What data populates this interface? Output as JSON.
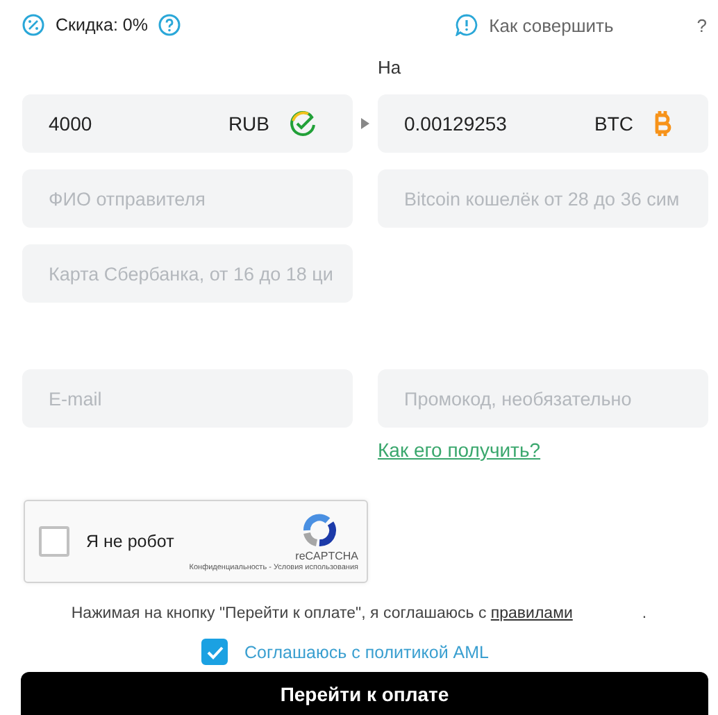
{
  "discount": {
    "label": "Скидка: 0%"
  },
  "how_to": {
    "label": "Как совершить",
    "end": "?"
  },
  "to_label": "На",
  "amounts": [
    {
      "value": "4000",
      "currency": "RUB",
      "kind": "check"
    },
    {
      "value": "0.00129253",
      "currency": "BTC",
      "kind": "bitcoin"
    }
  ],
  "field_rows": [
    [
      {
        "placeholder": "ФИО отправителя"
      },
      {
        "placeholder": "Bitcoin кошелёк от 28 до 36 сим"
      }
    ],
    [
      {
        "placeholder": "Карта Сбербанка, от 16 до 18 ци"
      }
    ],
    [
      {
        "placeholder": "E-mail"
      },
      {
        "placeholder": "Промокод, необязательно"
      }
    ]
  ],
  "promo_link": "Как его получить?",
  "captcha": {
    "checked": false,
    "label": "Я не робот",
    "brand": "reCAPTCHA",
    "links": "Конфиденциальность - Условия использования"
  },
  "agreement": {
    "text": "Нажимая на кнопку \"Перейти к оплате\", я соглашаюсь с",
    "link": "правилами",
    "end": "."
  },
  "aml": {
    "checked": true,
    "label": "Соглашаюсь с политикой AML"
  },
  "submit": "Перейти к оплате"
}
